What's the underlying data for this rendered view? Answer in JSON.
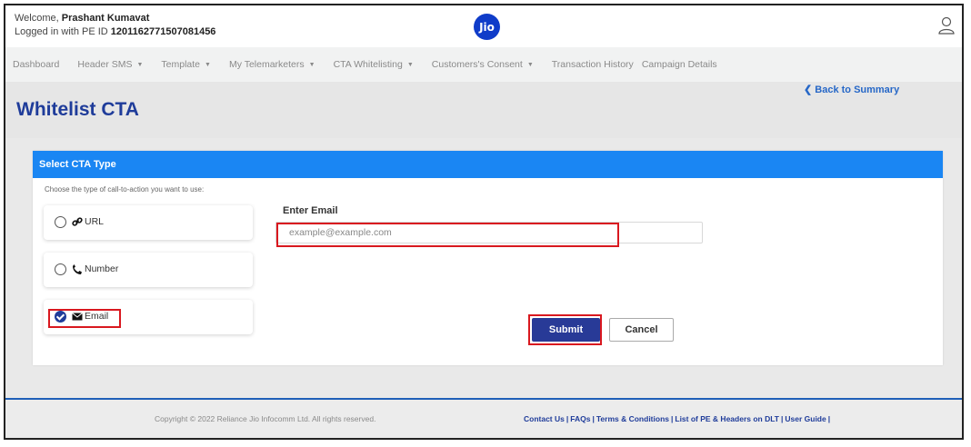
{
  "header": {
    "welcome_prefix": "Welcome,",
    "user_name": "Prashant Kumavat",
    "login_prefix": "Logged in with PE ID",
    "pe_id": "1201162771507081456",
    "logo_text": "Jio"
  },
  "nav": {
    "items": [
      {
        "label": "Dashboard",
        "dropdown": false
      },
      {
        "label": "Header SMS",
        "dropdown": true
      },
      {
        "label": "Template",
        "dropdown": true
      },
      {
        "label": "My Telemarketers",
        "dropdown": true
      },
      {
        "label": "CTA Whitelisting",
        "dropdown": true
      },
      {
        "label": "Customers's Consent",
        "dropdown": true
      },
      {
        "label": "Transaction History",
        "dropdown": false
      },
      {
        "label": "Campaign Details",
        "dropdown": false
      }
    ],
    "caret": "▼"
  },
  "page": {
    "title": "Whitelist CTA",
    "back_link": "❮ Back to Summary"
  },
  "form": {
    "card_title": "Select CTA Type",
    "instruction": "Choose the type of call-to-action you want to use:",
    "options": [
      {
        "label": "URL",
        "icon": "link-icon",
        "selected": false
      },
      {
        "label": "Number",
        "icon": "phone-icon",
        "selected": false
      },
      {
        "label": "Email",
        "icon": "envelope-icon",
        "selected": true
      }
    ],
    "email_label": "Enter Email",
    "email_placeholder": "example@example.com",
    "email_value": "",
    "submit_label": "Submit",
    "cancel_label": "Cancel"
  },
  "footer": {
    "copyright": "Copyright © 2022 Reliance Jio Infocomm Ltd. All rights reserved.",
    "links": [
      "Contact Us",
      "FAQs",
      "Terms & Conditions",
      "List of PE & Headers on DLT",
      "User Guide"
    ],
    "separator": "|"
  },
  "colors": {
    "brand_blue": "#1f3c9a",
    "card_header": "#1a86f3",
    "highlight_red": "#d9181f",
    "submit_bg": "#283a97"
  }
}
